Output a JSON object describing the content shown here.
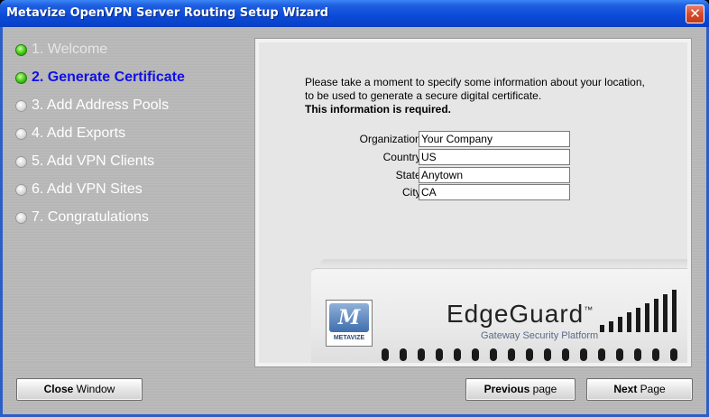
{
  "window": {
    "title": "Metavize OpenVPN Server Routing Setup Wizard",
    "close_glyph": "✕"
  },
  "steps": [
    {
      "label": "1. Welcome",
      "state": "done"
    },
    {
      "label": "2. Generate Certificate",
      "state": "current"
    },
    {
      "label": "3. Add Address Pools",
      "state": "pending"
    },
    {
      "label": "4. Add Exports",
      "state": "pending"
    },
    {
      "label": "5. Add VPN Clients",
      "state": "pending"
    },
    {
      "label": "6. Add VPN Sites",
      "state": "pending"
    },
    {
      "label": "7. Congratulations",
      "state": "pending"
    }
  ],
  "intro": {
    "line1": "Please take a moment to specify some information about your location,",
    "line2": "to be used to generate a secure digital certificate.",
    "line3": "This information is required."
  },
  "form": {
    "organization_label": "Organization:",
    "organization_value": "Your Company",
    "country_label": "Country:",
    "country_value": "US",
    "state_label": "State:",
    "state_value": "Anytown",
    "city_label": "City:",
    "city_value": "CA"
  },
  "device": {
    "logo_mark": "M",
    "logo_text": "METAVIZE",
    "brand": "EdgeGuard",
    "brand_tm": "™",
    "tagline": "Gateway Security Platform"
  },
  "buttons": {
    "close_bold": "Close",
    "close_rest": " Window",
    "previous_bold": "Previous",
    "previous_rest": " page",
    "next_bold": "Next",
    "next_rest": " Page"
  },
  "colors": {
    "titlebar": "#0a4ad8",
    "current_step": "#1010e8",
    "done_dot": "#3cc814"
  }
}
